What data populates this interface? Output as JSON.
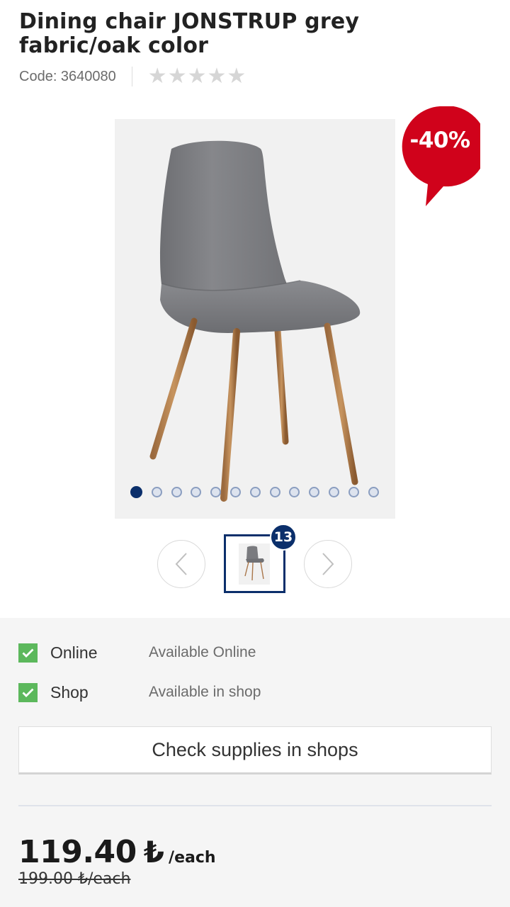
{
  "product": {
    "title": "Dining chair JONSTRUP grey fabric/oak color",
    "code": "Code: 3640080",
    "rating": {
      "stars_filled": 0,
      "stars_total": 5
    },
    "image_alt": "Grey fabric dining chair with oak color legs"
  },
  "gallery": {
    "discount_badge": "-40%",
    "image_count": "13",
    "current_index": 1,
    "dots_total": 13,
    "colors": {
      "active_dot": "#0b2f6b",
      "badge": "#d0021b"
    }
  },
  "availability": [
    {
      "label": "Online",
      "value": "Available Online",
      "icon": "check-icon"
    },
    {
      "label": "Shop",
      "value": "Available in shop",
      "icon": "check-icon"
    }
  ],
  "stock_button": "Check supplies in shops",
  "price": {
    "amount": "119.40",
    "currency": "₺",
    "unit": "/each",
    "old": "199.00 ₺/each"
  }
}
